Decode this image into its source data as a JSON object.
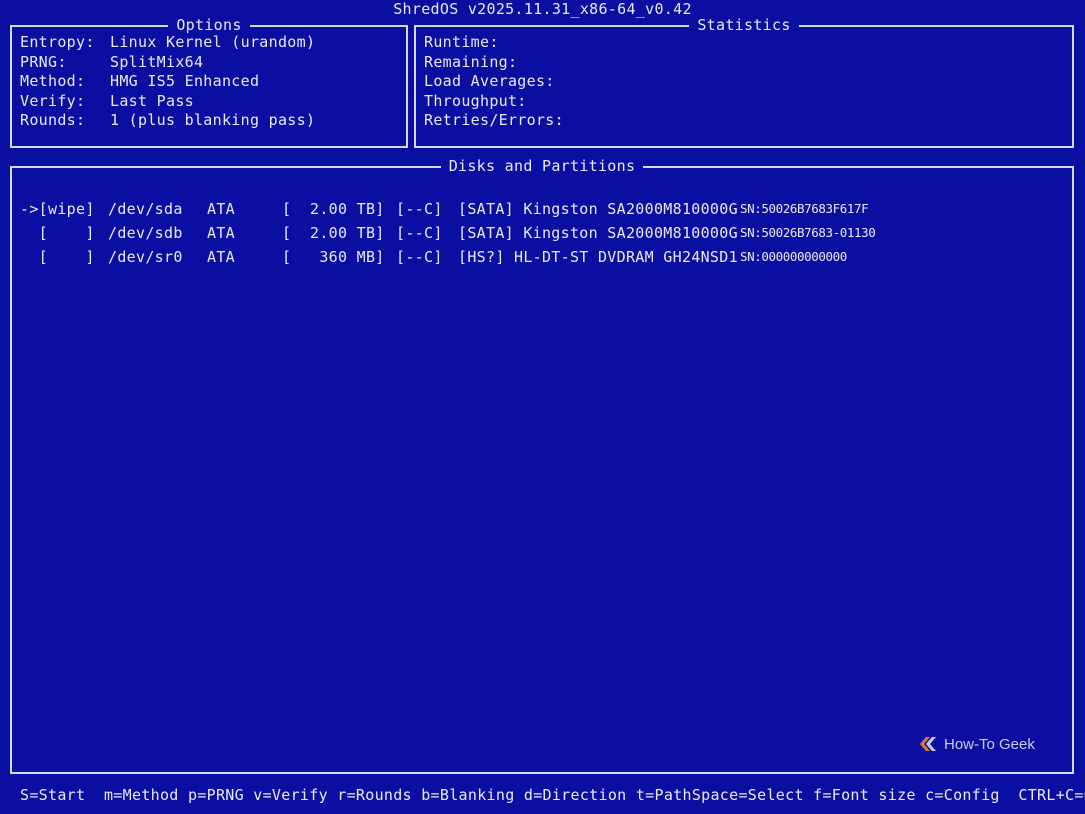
{
  "app": {
    "title": "ShredOS v2025.11.31_x86-64_v0.42"
  },
  "options": {
    "heading": "Options",
    "rows": [
      {
        "label": "Entropy:",
        "value": "Linux Kernel (urandom)"
      },
      {
        "label": "PRNG:",
        "value": "SplitMix64"
      },
      {
        "label": "Method:",
        "value": "HMG IS5 Enhanced"
      },
      {
        "label": "Verify:",
        "value": "Last Pass"
      },
      {
        "label": "Rounds:",
        "value": "1 (plus blanking pass)"
      }
    ]
  },
  "statistics": {
    "heading": "Statistics",
    "rows": [
      {
        "label": "Runtime:",
        "value": ""
      },
      {
        "label": "Remaining:",
        "value": ""
      },
      {
        "label": "Load Averages:",
        "value": ""
      },
      {
        "label": "Throughput:",
        "value": ""
      },
      {
        "label": "Retries/Errors:",
        "value": ""
      }
    ]
  },
  "disks": {
    "heading": "Disks and Partitions",
    "rows": [
      {
        "selector": "->[wipe]",
        "device": "/dev/sda",
        "bus": "ATA",
        "size": "[  2.00 TB]",
        "flags": "[--C]",
        "description": "[SATA] Kingston SA2000M810000G",
        "serial": "SN:50026B7683F617F",
        "selected": true
      },
      {
        "selector": "  [    ]",
        "device": "/dev/sdb",
        "bus": "ATA",
        "size": "[  2.00 TB]",
        "flags": "[--C]",
        "description": "[SATA] Kingston SA2000M810000G",
        "serial": "SN:50026B7683-01130",
        "selected": false
      },
      {
        "selector": "  [    ]",
        "device": "/dev/sr0",
        "bus": "ATA",
        "size": "[   360 MB]",
        "flags": "[--C]",
        "description": "[HS?] HL-DT-ST DVDRAM GH24NSD1",
        "serial": "SN:000000000000",
        "selected": false
      }
    ]
  },
  "footer": {
    "keys": "S=Start  m=Method p=PRNG v=Verify r=Rounds b=Blanking d=Direction t=PathSpace=Select f=Font size c=Config  CTRL+C=Quit"
  },
  "watermark": {
    "text": "How-To Geek",
    "icon": "htg-logo-icon"
  },
  "colors": {
    "background": "#0b0fa1",
    "text": "#e8e8f4",
    "border": "#d8d8ec"
  }
}
